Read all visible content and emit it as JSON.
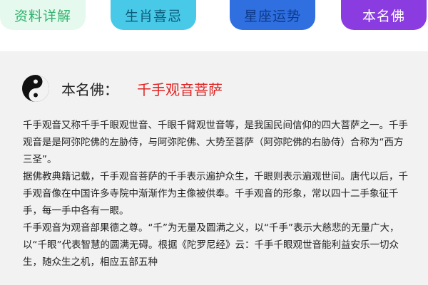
{
  "tabs": [
    {
      "label": "资料详解"
    },
    {
      "label": "生肖喜忌"
    },
    {
      "label": "星座运势"
    },
    {
      "label": "本名佛"
    }
  ],
  "profile": {
    "key_label": "本名佛：",
    "value": "千手观音菩萨",
    "icon": "yin-yang-icon"
  },
  "description": [
    "千手观音又称千手千眼观世音、千眼千臂观世音等，是我国民间信仰的四大菩萨之一。千手观音是是阿弥陀佛的左胁侍，与阿弥陀佛、大势至菩萨（阿弥陀佛的右胁侍）合称为“西方三圣”。",
    "据佛教典籍记载，千手观音菩萨的千手表示遍护众生，千眼则表示遍观世间。唐代以后，千手观音像在中国许多寺院中渐渐作为主像被供奉。千手观音的形象，常以四十二手象征千手，每一手中各有一眼。",
    "千手观音为观音部果德之尊。“千”为无量及圆满之义，以“千手”表示大慈悲的无量广大，以“千眼”代表智慧的圆满无碍。根据《陀罗尼经》云：千手千眼观世音能利益安乐一切众生，随众生之机，相应五部五种"
  ],
  "colors": {
    "accent": "#e02424",
    "content_bg": "#f2f2f2"
  }
}
